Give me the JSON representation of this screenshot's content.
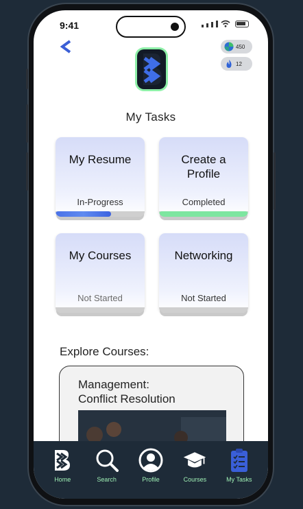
{
  "status_bar": {
    "time": "9:41"
  },
  "header": {
    "back_icon": "chevron-left-icon",
    "logo_icon": "b-logo-icon",
    "badges": [
      {
        "value": "450",
        "icon": "gem-icon"
      },
      {
        "value": "12",
        "icon": "flame-icon"
      }
    ]
  },
  "tasks": {
    "title": "My Tasks",
    "items": [
      {
        "title": "My Resume",
        "status": "In-Progress",
        "progress": 0.62
      },
      {
        "title": "Create a Profile",
        "status": "Completed",
        "progress": 1.0
      },
      {
        "title": "My Courses",
        "status": "Not Started",
        "progress": 0
      },
      {
        "title": "Networking",
        "status": "Not Started",
        "progress": 0
      }
    ]
  },
  "explore": {
    "title": "Explore Courses:",
    "course": {
      "line1": "Management:",
      "line2": "Conflict Resolution"
    }
  },
  "tabbar": {
    "items": [
      {
        "label": "Home",
        "icon": "b-logo-icon"
      },
      {
        "label": "Search",
        "icon": "search-icon"
      },
      {
        "label": "Profile",
        "icon": "user-icon"
      },
      {
        "label": "Courses",
        "icon": "graduation-cap-icon"
      },
      {
        "label": "My Tasks",
        "icon": "clipboard-checklist-icon"
      }
    ]
  },
  "colors": {
    "accent_green": "#9ff0b5",
    "progress_blue": "#4a72e8",
    "progress_green": "#7ee6a0",
    "card_blue": "#d6dcf8",
    "nav_bg": "#1e2b38"
  }
}
